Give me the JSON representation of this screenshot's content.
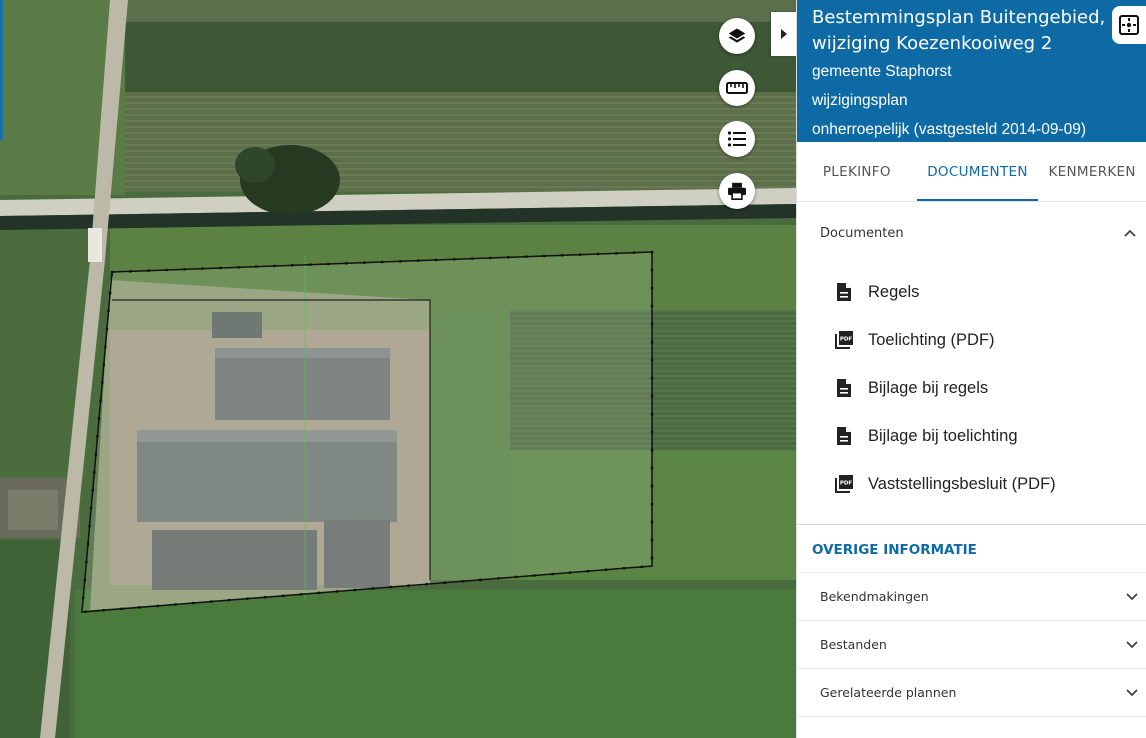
{
  "map": {
    "tools": [
      {
        "name": "layers",
        "icon": "layers-icon"
      },
      {
        "name": "measure",
        "icon": "ruler-icon"
      },
      {
        "name": "legend",
        "icon": "list-icon"
      },
      {
        "name": "print",
        "icon": "printer-icon"
      }
    ],
    "collapse_icon": "chevron-right-icon"
  },
  "panel": {
    "title": "Bestemmingsplan Buitengebied, wijziging Koezenkooiweg 2",
    "municipality": "gemeente Staphorst",
    "plan_type": "wijzigingsplan",
    "status": "onherroepelijk (vastgesteld 2014-09-09)",
    "header_color": "#0d6aa5",
    "tabs": [
      {
        "label": "PLEKINFO",
        "active": false
      },
      {
        "label": "DOCUMENTEN",
        "active": true
      },
      {
        "label": "KENMERKEN",
        "active": false
      }
    ],
    "documents": {
      "heading": "Documenten",
      "expanded": true,
      "items": [
        {
          "label": "Regels",
          "icon": "document-icon"
        },
        {
          "label": "Toelichting (PDF)",
          "icon": "pdf-icon"
        },
        {
          "label": "Bijlage bij regels",
          "icon": "document-icon"
        },
        {
          "label": "Bijlage bij toelichting",
          "icon": "document-icon"
        },
        {
          "label": "Vaststellingsbesluit (PDF)",
          "icon": "pdf-icon"
        }
      ]
    },
    "other": {
      "heading": "OVERIGE INFORMATIE",
      "rows": [
        {
          "label": "Bekendmakingen"
        },
        {
          "label": "Bestanden"
        },
        {
          "label": "Gerelateerde plannen"
        }
      ]
    }
  }
}
